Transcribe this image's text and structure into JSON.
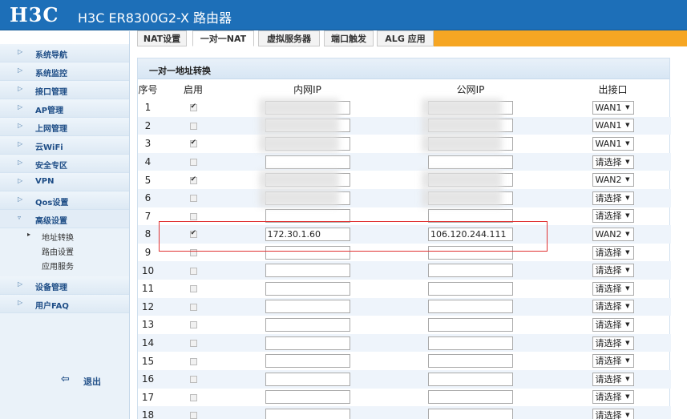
{
  "header": {
    "logo": "H3C",
    "title": "H3C ER8300G2-X 路由器"
  },
  "sidebar": {
    "items": [
      {
        "label": "系统导航"
      },
      {
        "label": "系统监控"
      },
      {
        "label": "接口管理"
      },
      {
        "label": "AP管理"
      },
      {
        "label": "上网管理"
      },
      {
        "label": "云WiFi"
      },
      {
        "label": "安全专区"
      },
      {
        "label": "VPN"
      },
      {
        "label": "Qos设置"
      },
      {
        "label": "高级设置"
      }
    ],
    "sub_items": [
      {
        "label": "地址转换"
      },
      {
        "label": "路由设置"
      },
      {
        "label": "应用服务"
      }
    ],
    "items_after": [
      {
        "label": "设备管理"
      },
      {
        "label": "用户FAQ"
      }
    ],
    "logout_label": "退出"
  },
  "tabs": [
    {
      "label": "NAT设置"
    },
    {
      "label": "一对一NAT"
    },
    {
      "label": "虚拟服务器"
    },
    {
      "label": "端口触发"
    },
    {
      "label": "ALG 应用"
    }
  ],
  "panel": {
    "title": "一对一地址转换",
    "columns": [
      "序号",
      "启用",
      "内网IP",
      "公网IP",
      "出接口"
    ]
  },
  "rows": [
    {
      "no": "1",
      "enabled": true,
      "inner": "",
      "outer": "",
      "iface": "WAN1"
    },
    {
      "no": "2",
      "enabled": false,
      "inner": "",
      "outer": "",
      "iface": "WAN1"
    },
    {
      "no": "3",
      "enabled": true,
      "inner": "",
      "outer": "",
      "iface": "WAN1"
    },
    {
      "no": "4",
      "enabled": false,
      "inner": "",
      "outer": "",
      "iface": "请选择"
    },
    {
      "no": "5",
      "enabled": true,
      "inner": "",
      "outer": "",
      "iface": "WAN2"
    },
    {
      "no": "6",
      "enabled": false,
      "inner": "",
      "outer": "",
      "iface": "请选择"
    },
    {
      "no": "7",
      "enabled": false,
      "inner": "",
      "outer": "",
      "iface": "请选择"
    },
    {
      "no": "8",
      "enabled": true,
      "inner": "172.30.1.60",
      "outer": "106.120.244.111",
      "iface": "WAN2"
    },
    {
      "no": "9",
      "enabled": false,
      "inner": "",
      "outer": "",
      "iface": "请选择"
    },
    {
      "no": "10",
      "enabled": false,
      "inner": "",
      "outer": "",
      "iface": "请选择"
    },
    {
      "no": "11",
      "enabled": false,
      "inner": "",
      "outer": "",
      "iface": "请选择"
    },
    {
      "no": "12",
      "enabled": false,
      "inner": "",
      "outer": "",
      "iface": "请选择"
    },
    {
      "no": "13",
      "enabled": false,
      "inner": "",
      "outer": "",
      "iface": "请选择"
    },
    {
      "no": "14",
      "enabled": false,
      "inner": "",
      "outer": "",
      "iface": "请选择"
    },
    {
      "no": "15",
      "enabled": false,
      "inner": "",
      "outer": "",
      "iface": "请选择"
    },
    {
      "no": "16",
      "enabled": false,
      "inner": "",
      "outer": "",
      "iface": "请选择"
    },
    {
      "no": "17",
      "enabled": false,
      "inner": "",
      "outer": "",
      "iface": "请选择"
    },
    {
      "no": "18",
      "enabled": false,
      "inner": "",
      "outer": "",
      "iface": "请选择"
    }
  ],
  "blurred_rows": [
    1,
    2,
    3,
    5,
    6
  ]
}
